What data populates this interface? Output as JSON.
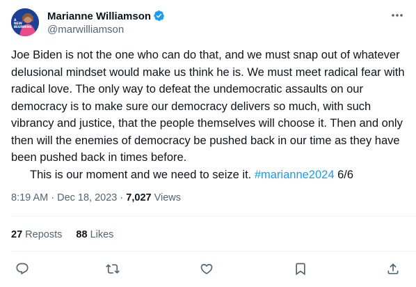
{
  "author": {
    "name": "Marianne Williamson",
    "handle": "@marwilliamson",
    "avatar_text": "A NEW BEGINNING",
    "verified_icon": "verified-badge-icon"
  },
  "tweet": {
    "paragraph_1": "Joe Biden is not the one who can do that, and we must snap out of whatever delusional mindset would make us think he is. We must meet radical fear with radical love. The only way to defeat the undemocratic assaults on our democracy is to make sure our democracy delivers so much, with such vibrancy and justice, that the people themselves will choose it. Then and only then will the enemies of democracy be pushed back in our time as they have been pushed back in times before.",
    "paragraph_2": "This is our moment and we need to seize it.",
    "hashtag": "#marianne2024",
    "thread_counter": "6/6"
  },
  "meta": {
    "time": "8:19 AM",
    "separator": "·",
    "date": "Dec 18, 2023",
    "views_count": "7,027",
    "views_label": "Views"
  },
  "stats": {
    "reposts_count": "27",
    "reposts_label": "Reposts",
    "likes_count": "88",
    "likes_label": "Likes"
  },
  "actions": [
    "reply-icon",
    "repost-icon",
    "like-icon",
    "bookmark-icon",
    "share-icon"
  ],
  "colors": {
    "text": "#0f1419",
    "secondary": "#536471",
    "link": "#1d9bf0",
    "verified": "#1d9bf0",
    "divider": "#eff3f4"
  }
}
